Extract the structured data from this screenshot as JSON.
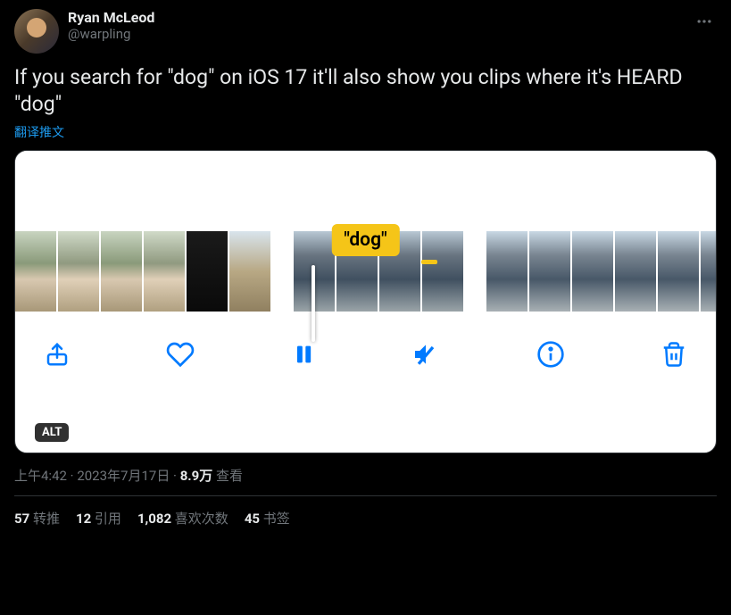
{
  "user": {
    "display_name": "Ryan McLeod",
    "username": "@warpling"
  },
  "tweet_text": "If you search for \"dog\" on iOS 17 it'll also show you clips where it's HEARD \"dog\"",
  "translate_label": "翻译推文",
  "media": {
    "caption": "\"dog\"",
    "alt_badge": "ALT"
  },
  "meta": {
    "time": "上午4:42",
    "date": "2023年7月17日",
    "views_count": "8.9万",
    "views_label": "查看"
  },
  "stats": {
    "retweets": {
      "count": "57",
      "label": "转推"
    },
    "quotes": {
      "count": "12",
      "label": "引用"
    },
    "likes": {
      "count": "1,082",
      "label": "喜欢次数"
    },
    "bookmarks": {
      "count": "45",
      "label": "书签"
    }
  }
}
